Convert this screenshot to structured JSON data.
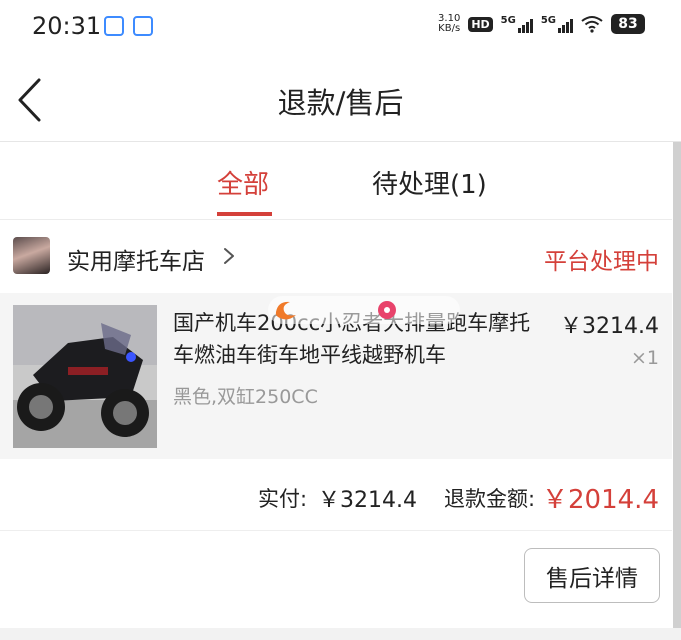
{
  "status_bar": {
    "time": "20:31",
    "net_speed_value": "3.10",
    "net_speed_unit": "KB/s",
    "hd_label": "HD",
    "signal_1": "5G",
    "signal_2": "5G",
    "battery": "83",
    "icons": [
      "app-notification-icon",
      "mail-app-icon",
      "wifi-icon"
    ]
  },
  "nav": {
    "title": "退款/售后",
    "back_icon": "chevron-left-icon"
  },
  "tabs": [
    {
      "label": "全部",
      "active": true
    },
    {
      "label": "待处理(1)",
      "active": false
    }
  ],
  "order": {
    "shop_name": "实用摩托车店",
    "status": "平台处理中",
    "product": {
      "title": "国产机车200cc小忍者大排量跑车摩托车燃油车街车地平线越野机车",
      "spec": "黑色,双缸250CC",
      "price": "￥3214.4",
      "quantity": "×1"
    },
    "paid_label": "实付:",
    "paid_value": "￥3214.4",
    "refund_label": "退款金额:",
    "refund_value": "￥2014.4",
    "detail_button": "售后详情"
  },
  "colors": {
    "accent": "#d4403a",
    "text": "#222222",
    "muted": "#999999",
    "product_bg": "#f5f5f5"
  }
}
